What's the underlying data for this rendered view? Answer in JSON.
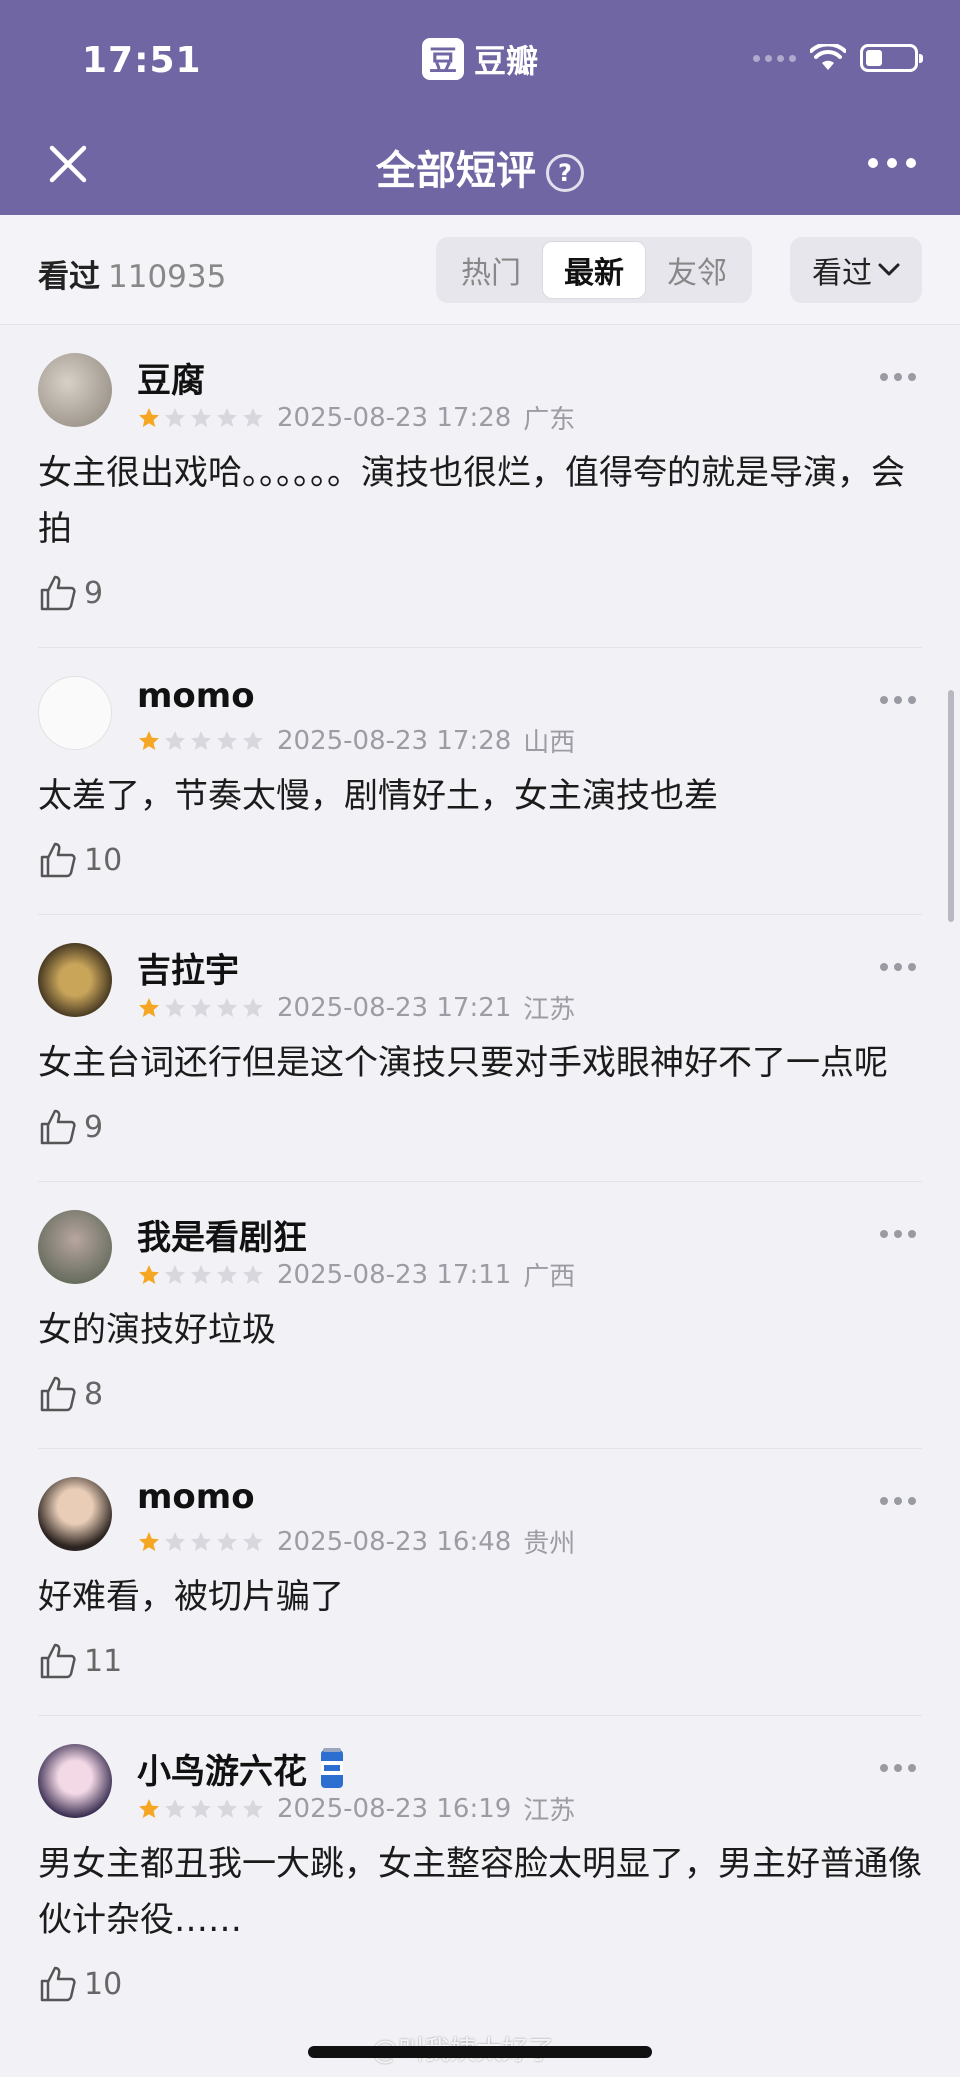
{
  "status": {
    "time": "17:51",
    "app_logo_char": "豆",
    "app_name": "豆瓣"
  },
  "nav": {
    "title": "全部短评",
    "help": "?"
  },
  "filter": {
    "label": "看过",
    "count": "110935",
    "tabs": [
      "热门",
      "最新",
      "友邻"
    ],
    "active_tab": "最新",
    "sort_label": "看过"
  },
  "colors": {
    "header": "#6f66a3",
    "star_filled": "#f5a623",
    "star_empty": "#d7d7dd"
  },
  "reviews": [
    {
      "user": "豆腐",
      "rating": 1,
      "date": "2025-08-23 17:28",
      "location": "广东",
      "text": "女主很出戏哈。。。。。。演技也很烂，值得夸的就是导演，会拍",
      "likes": "9"
    },
    {
      "user": "momo",
      "rating": 1,
      "date": "2025-08-23 17:28",
      "location": "山西",
      "text": "太差了，节奏太慢，剧情好土，女主演技也差",
      "likes": "10"
    },
    {
      "user": "吉拉宇",
      "rating": 1,
      "date": "2025-08-23 17:21",
      "location": "江苏",
      "text": "女主台词还行但是这个演技只要对手戏眼神好不了一点呢",
      "likes": "9"
    },
    {
      "user": "我是看剧狂",
      "rating": 1,
      "date": "2025-08-23 17:11",
      "location": "广西",
      "text": "女的演技好垃圾",
      "likes": "8"
    },
    {
      "user": "momo",
      "rating": 1,
      "date": "2025-08-23 16:48",
      "location": "贵州",
      "text": "好难看，被切片骗了",
      "likes": "11"
    },
    {
      "user": "小鸟游六花",
      "rating": 1,
      "date": "2025-08-23 16:19",
      "location": "江苏",
      "text": "男女主都丑我一大跳，女主整容脸太明显了，男主好普通像伙计杂役……",
      "likes": "10"
    }
  ],
  "watermark": "@叫我姨太好了"
}
